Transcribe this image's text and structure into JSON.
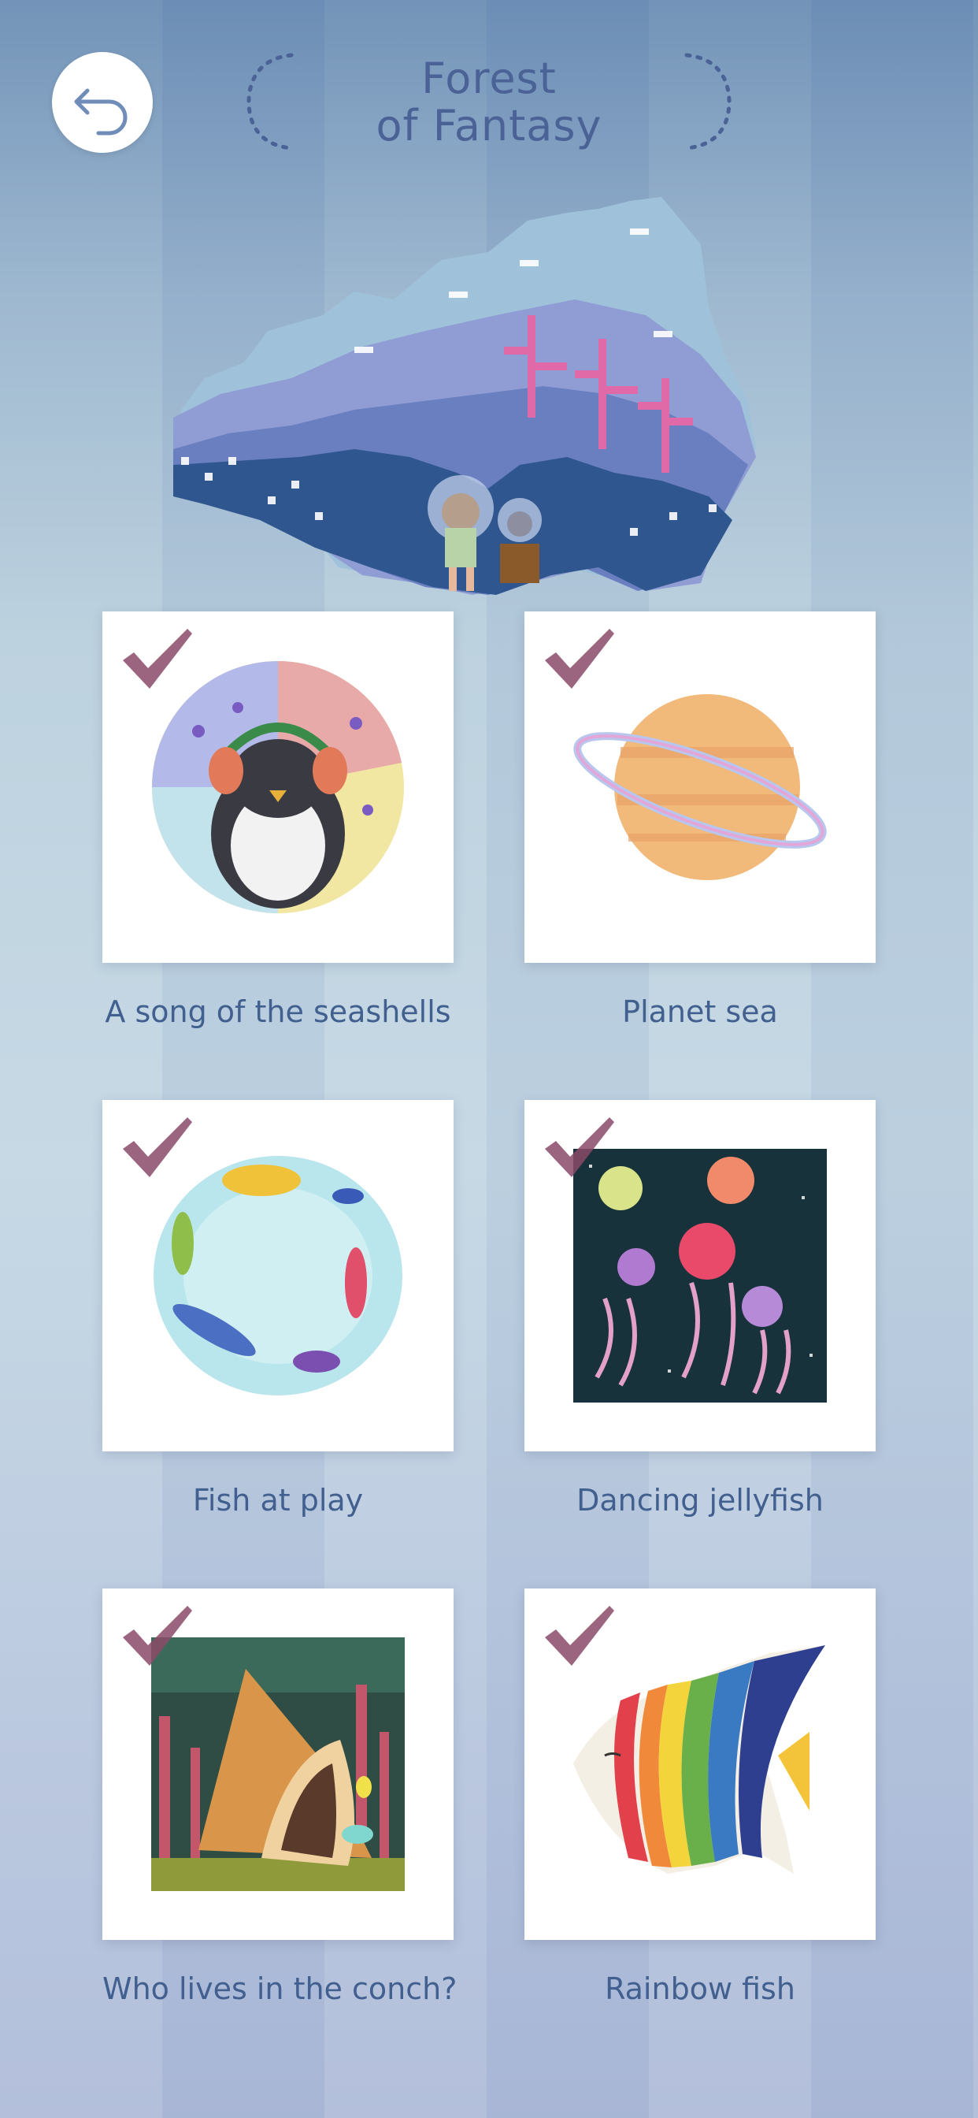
{
  "header": {
    "back_icon": "back-arrow-icon",
    "title_line1": "Forest",
    "title_line2": "of Fantasy"
  },
  "colors": {
    "title": "#4a6296",
    "label": "#42608f",
    "check": "#8b4a68",
    "tile_bg": "#ffffff"
  },
  "artworks": [
    {
      "title": "A song of the seashells",
      "completed": true,
      "art_icon": "penguin-headphones-art"
    },
    {
      "title": "Planet sea",
      "completed": true,
      "art_icon": "ringed-planet-art"
    },
    {
      "title": "Fish at play",
      "completed": true,
      "art_icon": "fish-circle-art"
    },
    {
      "title": "Dancing jellyfish",
      "completed": true,
      "art_icon": "jellyfish-art"
    },
    {
      "title": "Who lives in the conch?",
      "completed": true,
      "art_icon": "conch-shell-art"
    },
    {
      "title": "Rainbow fish",
      "completed": true,
      "art_icon": "rainbow-fish-art"
    }
  ]
}
